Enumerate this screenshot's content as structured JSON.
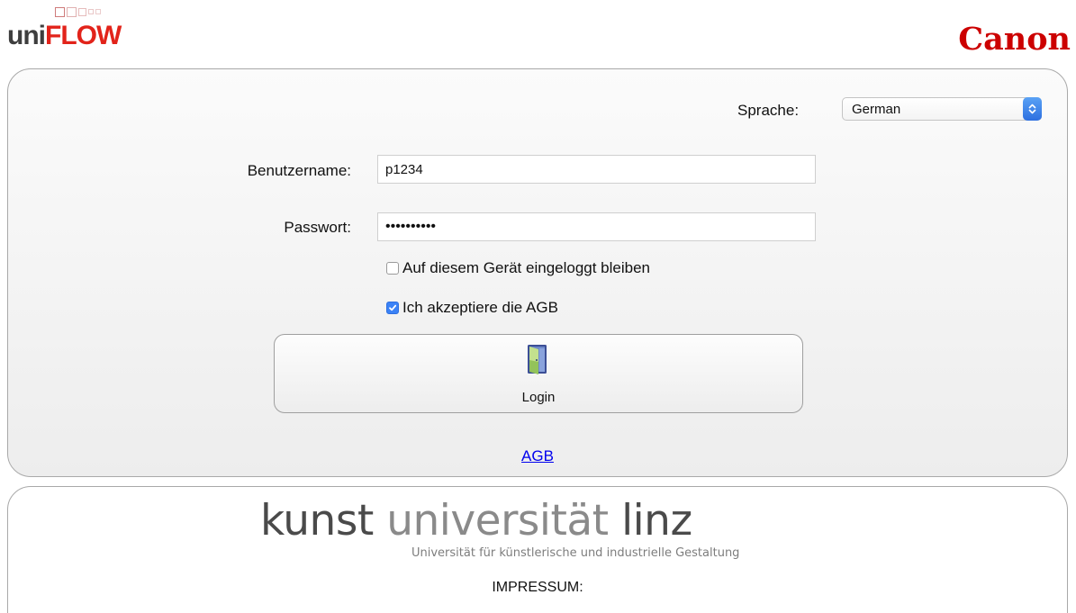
{
  "header": {
    "uniflow_logo": {
      "uni": "uni",
      "flow": "FLOW"
    },
    "canon_logo": "Canon"
  },
  "login_form": {
    "language": {
      "label": "Sprache:",
      "selected": "German"
    },
    "username": {
      "label": "Benutzername:",
      "value": "p1234"
    },
    "password": {
      "label": "Passwort:",
      "value": "••••••••••"
    },
    "stay_logged_in": {
      "label": "Auf diesem Gerät eingeloggt bleiben",
      "checked": false
    },
    "accept_terms": {
      "label": "Ich akzeptiere die AGB",
      "checked": true
    },
    "login_button": {
      "label": "Login",
      "icon": "door-icon"
    },
    "agb_link": "AGB"
  },
  "footer": {
    "logo": {
      "word1": "kunst",
      "word2": "universität",
      "word3": "linz",
      "tagline": "Universität für künstlerische und industrielle Gestaltung"
    },
    "impressum": "IMPRESSUM:"
  },
  "colors": {
    "uniflow_red": "#e2231a",
    "canon_red": "#cc0000",
    "link_blue": "#0000ee",
    "checkbox_blue": "#3b82f6"
  }
}
